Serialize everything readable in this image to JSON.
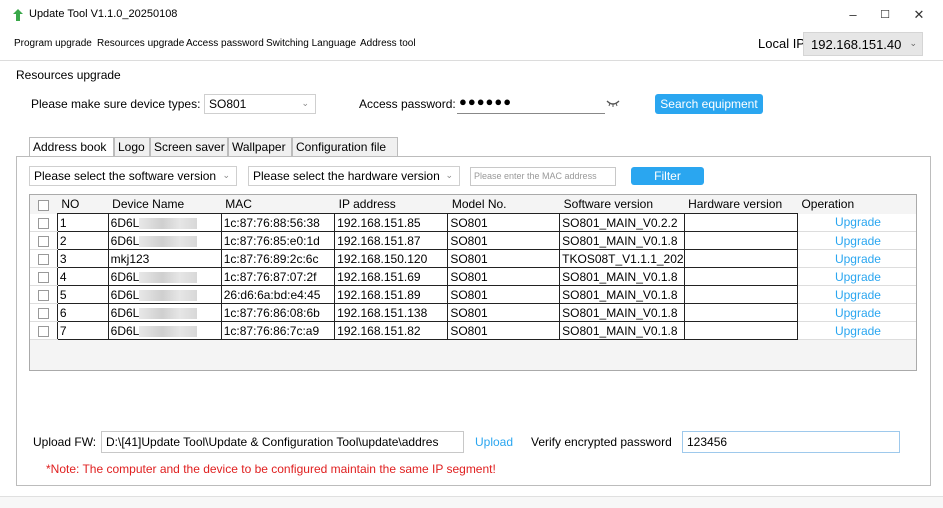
{
  "window": {
    "title": "Update Tool V1.1.0_20250108",
    "minimize": "–",
    "maximize": "☐",
    "close": "✕"
  },
  "menu": [
    "Program upgrade",
    "Resources upgrade",
    "Access password",
    "Switching Language",
    "Address tool"
  ],
  "local_ip": {
    "label": "Local IP:",
    "value": "192.168.151.40"
  },
  "section_title": "Resources upgrade",
  "device_type": {
    "label": "Please make sure device types:",
    "value": "SO801"
  },
  "access_password": {
    "label": "Access password:",
    "value": "●●●●●●"
  },
  "search_button": "Search equipment",
  "tabs": [
    "Address book",
    "Logo",
    "Screen saver",
    "Wallpaper",
    "Configuration file"
  ],
  "filters": {
    "software": "Please select the software version",
    "hardware": "Please select the hardware version",
    "mac_placeholder": "Please enter the MAC address",
    "filter_button": "Filter"
  },
  "table": {
    "columns": [
      "",
      "NO",
      "Device Name",
      "MAC",
      "IP address",
      "Model No.",
      "Software version",
      "Hardware version",
      "Operation"
    ],
    "rows": [
      {
        "no": "1",
        "name": "6D6L",
        "mac": "1c:87:76:88:56:38",
        "ip": "192.168.151.85",
        "model": "SO801",
        "sw": "SO801_MAIN_V0.2.2",
        "hw": "",
        "op": "Upgrade"
      },
      {
        "no": "2",
        "name": "6D6L",
        "mac": "1c:87:76:85:e0:1d",
        "ip": "192.168.151.87",
        "model": "SO801",
        "sw": "SO801_MAIN_V0.1.8",
        "hw": "",
        "op": "Upgrade"
      },
      {
        "no": "3",
        "name": "mkj123",
        "mac": "1c:87:76:89:2c:6c",
        "ip": "192.168.150.120",
        "model": "SO801",
        "sw": "TKOS08T_V1.1.1_202",
        "hw": "",
        "op": "Upgrade"
      },
      {
        "no": "4",
        "name": "6D6L",
        "mac": "1c:87:76:87:07:2f",
        "ip": "192.168.151.69",
        "model": "SO801",
        "sw": "SO801_MAIN_V0.1.8",
        "hw": "",
        "op": "Upgrade"
      },
      {
        "no": "5",
        "name": "6D6L",
        "mac": "26:d6:6a:bd:e4:45",
        "ip": "192.168.151.89",
        "model": "SO801",
        "sw": "SO801_MAIN_V0.1.8",
        "hw": "",
        "op": "Upgrade"
      },
      {
        "no": "6",
        "name": "6D6L",
        "mac": "1c:87:76:86:08:6b",
        "ip": "192.168.151.138",
        "model": "SO801",
        "sw": "SO801_MAIN_V0.1.8",
        "hw": "",
        "op": "Upgrade"
      },
      {
        "no": "7",
        "name": "6D6L",
        "mac": "1c:87:76:86:7c:a9",
        "ip": "192.168.151.82",
        "model": "SO801",
        "sw": "SO801_MAIN_V0.1.8",
        "hw": "",
        "op": "Upgrade"
      }
    ]
  },
  "upload": {
    "label": "Upload FW:",
    "path": "D:\\[41]Update Tool\\Update & Configuration Tool\\update\\addres",
    "button": "Upload"
  },
  "verify": {
    "label": "Verify encrypted password",
    "value": "123456"
  },
  "note": "*Note: The computer and the device to be configured maintain the same IP segment!",
  "colors": {
    "accent": "#2aa6f0",
    "note": "#e02020"
  },
  "icons": [
    "app-arrow-icon",
    "eye-icon",
    "chevron-down-icon"
  ]
}
